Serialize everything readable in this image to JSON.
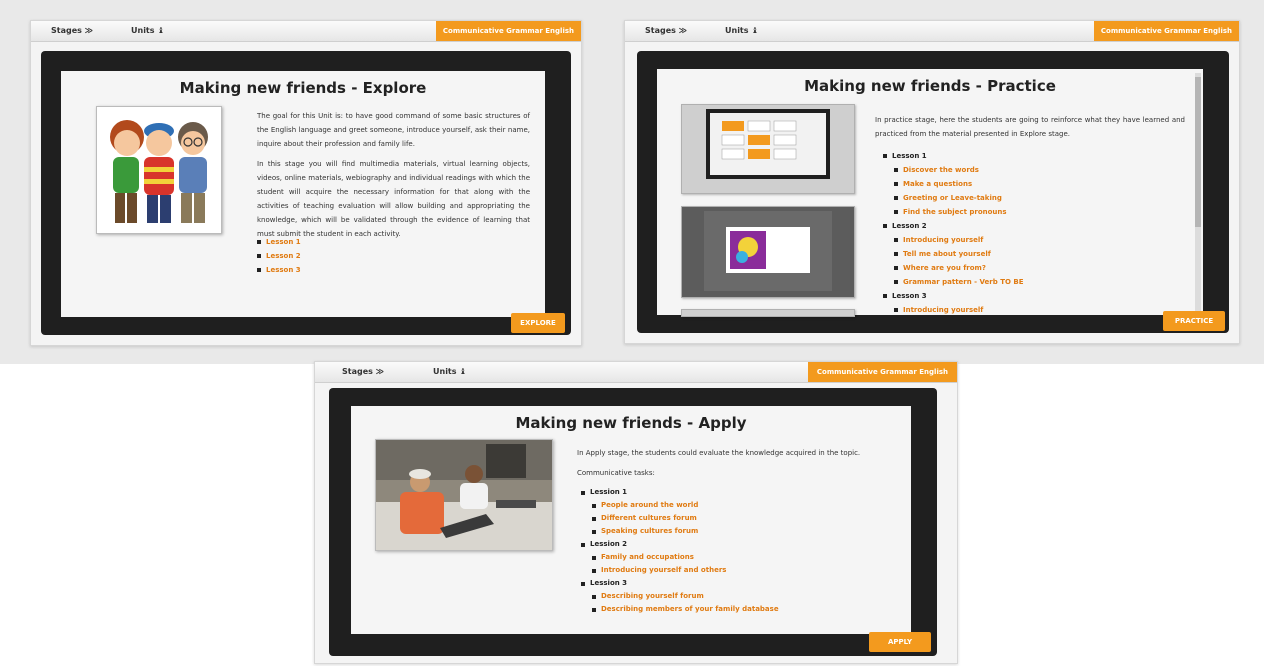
{
  "course_label": "Communicative Grammar English",
  "nav": {
    "stages": "Stages ≫",
    "units": "Units ♝"
  },
  "explore": {
    "title": "Making new friends - Explore",
    "paragraph1": "The goal for this Unit is: to have good command of some basic structures of the English language and greet someone, introduce yourself, ask their name, inquire about their profession and family life.",
    "paragraph2": "In this stage you will find multimedia materials, virtual learning objects, videos, online materials, webiography and individual readings with which the student will acquire the necessary information for that along with the activities of teaching evaluation will allow building and appropriating the knowledge, which will be validated through the evidence of learning that must submit the student in each activity.",
    "lessons": [
      "Lesson 1",
      "Lesson 2",
      "Lesson 3"
    ],
    "button": "EXPLORE"
  },
  "practice": {
    "title": "Making new friends - Practice",
    "intro": "In practice stage, here the students are going to reinforce what they have learned and practiced from the material presented in Explore stage.",
    "lesson1": "Lesson 1",
    "lesson1_items": [
      "Discover the words",
      "Make a questions",
      "Greeting or Leave-taking",
      "Find the subject pronouns"
    ],
    "lesson2": "Lesson 2",
    "lesson2_items": [
      "Introducing yourself",
      "Tell me about yourself",
      "Where are you from?",
      "Grammar pattern - Verb TO BE"
    ],
    "lesson3": "Lesson 3",
    "lesson3_items": [
      "Introducing yourself"
    ],
    "button": "PRACTICE"
  },
  "apply": {
    "title": "Making new friends - Apply",
    "intro": "In Apply stage, the students could evaluate the knowledge acquired in the topic.",
    "tasks_label": "Communicative tasks:",
    "lesson1": "Lession 1",
    "lesson1_items": [
      "People around the world",
      "Different cultures forum",
      "Speaking cultures forum"
    ],
    "lesson2": "Lession 2",
    "lesson2_items": [
      "Family and occupations",
      "Introducing yourself and others"
    ],
    "lesson3": "Lession 3",
    "lesson3_items": [
      "Describing yourself forum",
      "Describing members of your family database"
    ],
    "button": "APPLY"
  },
  "colors": {
    "accent": "#f39a1e",
    "link": "#e07b12",
    "stage_frame": "#1f1f1f"
  }
}
